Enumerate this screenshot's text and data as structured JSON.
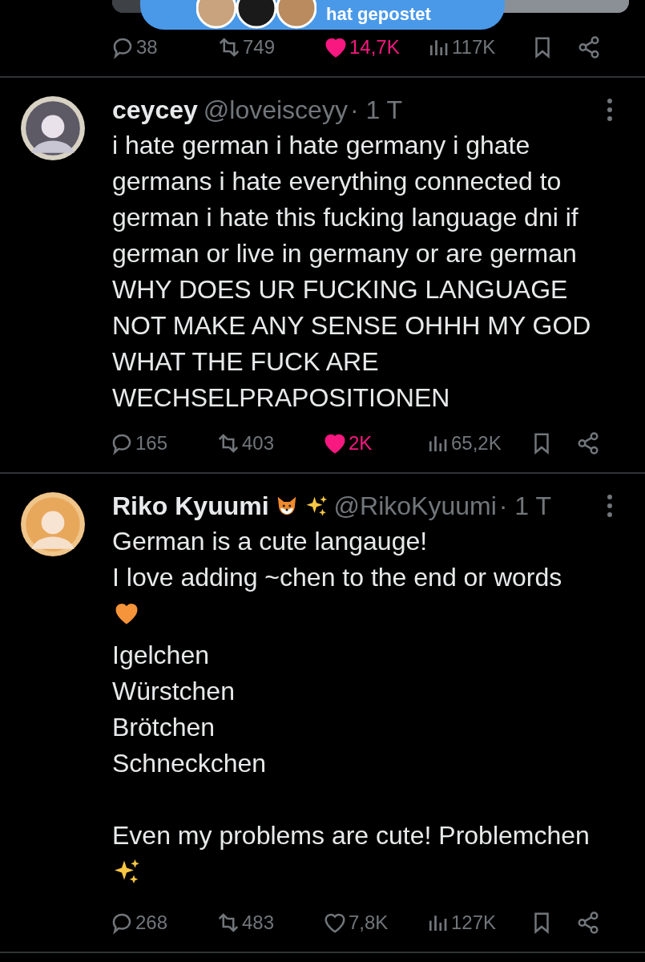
{
  "banner": {
    "text": "hat gepostet"
  },
  "top_stats": {
    "replies": "38",
    "reposts": "749",
    "likes": "14,7K",
    "liked": true,
    "views": "117K"
  },
  "posts": [
    {
      "name": "ceycey",
      "handle": "@loveisceyy",
      "time": "· 1 T",
      "body": [
        {
          "kind": "text",
          "text": "i hate german i hate germany i ghate germans i hate everything connected to german i hate this fucking language dni if german or live in germany or are german WHY DOES UR FUCKING LANGUAGE NOT MAKE ANY SENSE OHHH MY GOD WHAT THE FUCK ARE WECHSELPRAPOSITIONEN"
        }
      ],
      "stats": {
        "replies": "165",
        "reposts": "403",
        "likes": "2K",
        "liked": true,
        "views": "65,2K"
      }
    },
    {
      "name": "Riko Kyuumi",
      "badges": [
        {
          "kind": "fox"
        },
        {
          "kind": "sparkles"
        }
      ],
      "handle": "@RikoKyuumi",
      "time": "· 1 T",
      "body": [
        {
          "kind": "text",
          "text": "German is a cute langauge!"
        },
        {
          "kind": "text",
          "text": "I love adding ~chen to the end or words"
        },
        {
          "kind": "heart"
        },
        {
          "kind": "text",
          "text": "Igelchen"
        },
        {
          "kind": "text",
          "text": "Würstchen"
        },
        {
          "kind": "text",
          "text": "Brötchen"
        },
        {
          "kind": "text",
          "text": "Schneckchen"
        },
        {
          "kind": "blank"
        },
        {
          "kind": "text",
          "text": "Even my problems are cute! Problemchen"
        },
        {
          "kind": "sparkles"
        }
      ],
      "stats": {
        "replies": "268",
        "reposts": "483",
        "likes": "7,8K",
        "liked": false,
        "views": "127K"
      }
    }
  ]
}
